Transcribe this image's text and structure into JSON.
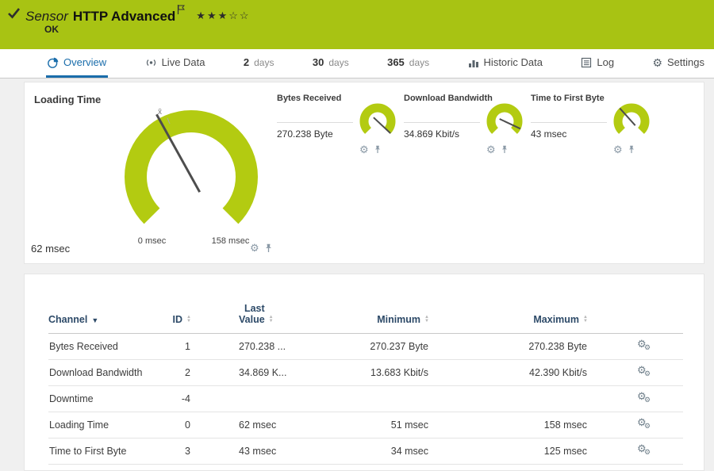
{
  "header": {
    "kind": "Sensor",
    "title": "HTTP Advanced",
    "status": "OK",
    "stars": "★★★☆☆"
  },
  "tabs": [
    {
      "label": "Overview"
    },
    {
      "label": "Live Data"
    },
    {
      "value": "2",
      "unit": "days"
    },
    {
      "value": "30",
      "unit": "days"
    },
    {
      "value": "365",
      "unit": "days"
    },
    {
      "label": "Historic Data"
    },
    {
      "label": "Log"
    },
    {
      "label": "Settings"
    }
  ],
  "gauges": {
    "primary": {
      "label": "Loading Time",
      "value": "62 msec",
      "scale_min": "0 msec",
      "scale_max": "158 msec",
      "mean_marker": "x̄"
    },
    "minis": [
      {
        "label": "Bytes Received",
        "value": "270.238 Byte"
      },
      {
        "label": "Download Bandwidth",
        "value": "34.869 Kbit/s"
      },
      {
        "label": "Time to First Byte",
        "value": "43 msec"
      }
    ]
  },
  "table": {
    "headers": {
      "channel": "Channel",
      "id": "ID",
      "last_value_line1": "Last",
      "last_value_line2": "Value",
      "minimum": "Minimum",
      "maximum": "Maximum"
    },
    "rows": [
      {
        "channel": "Bytes Received",
        "id": "1",
        "last_value": "270.238 ...",
        "minimum": "270.237 Byte",
        "maximum": "270.238 Byte"
      },
      {
        "channel": "Download Bandwidth",
        "id": "2",
        "last_value": "34.869 K...",
        "minimum": "13.683 Kbit/s",
        "maximum": "42.390 Kbit/s"
      },
      {
        "channel": "Downtime",
        "id": "-4",
        "last_value": "",
        "minimum": "",
        "maximum": ""
      },
      {
        "channel": "Loading Time",
        "id": "0",
        "last_value": "62 msec",
        "minimum": "51 msec",
        "maximum": "158 msec"
      },
      {
        "channel": "Time to First Byte",
        "id": "3",
        "last_value": "43 msec",
        "minimum": "34 msec",
        "maximum": "125 msec"
      }
    ]
  },
  "icons": {
    "gear": "⚙",
    "sort_asc": "▲",
    "sort_desc": "▼",
    "caret_down": "▼"
  },
  "colors": {
    "brand_green": "#a8c313",
    "accent_blue": "#1a6dab",
    "gauge_green": "#b3cb11"
  }
}
